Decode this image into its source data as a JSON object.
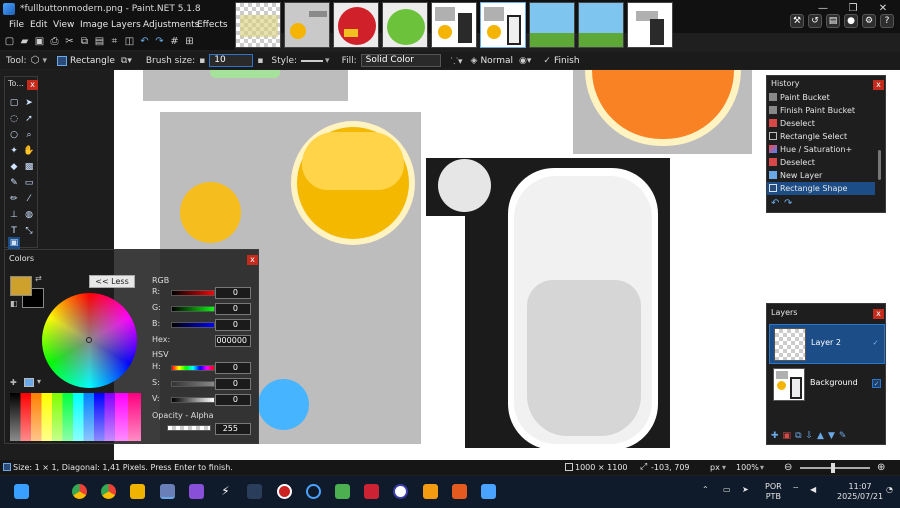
{
  "window": {
    "title": "*fullbuttonmodern.png - Paint.NET 5.1.8",
    "minimize": "—",
    "maximize": "❐",
    "close": "✕"
  },
  "menu": {
    "items": [
      "File",
      "Edit",
      "View",
      "Image",
      "Layers",
      "Adjustments",
      "Effects"
    ]
  },
  "tool_options": {
    "tool_label": "Tool:",
    "shape_label": "Rectangle",
    "brush_size_label": "Brush size:",
    "brush_size_value": "10",
    "style_label": "Style:",
    "fill_label": "Fill:",
    "fill_value": "Solid Color",
    "blend_value": "Normal",
    "finish_label": "Finish"
  },
  "tools_panel": {
    "title": "To..."
  },
  "colors_panel": {
    "title": "Colors",
    "less_button": "<< Less",
    "rgb_label": "RGB",
    "r_label": "R:",
    "g_label": "G:",
    "b_label": "B:",
    "r_value": "0",
    "g_value": "0",
    "b_value": "0",
    "hex_label": "Hex:",
    "hex_value": "000000",
    "hsv_label": "HSV",
    "h_label": "H:",
    "s_label": "S:",
    "v_label": "V:",
    "h_value": "0",
    "s_value": "0",
    "v_value": "0",
    "opacity_label": "Opacity - Alpha",
    "alpha_value": "255",
    "primary_color": "#cda12b",
    "secondary_color": "#000000"
  },
  "history_panel": {
    "title": "History",
    "items": [
      {
        "label": "Paint Bucket",
        "icon": "paint-bucket-icon"
      },
      {
        "label": "Finish Paint Bucket",
        "icon": "paint-bucket-icon"
      },
      {
        "label": "Deselect",
        "icon": "deselect-icon"
      },
      {
        "label": "Rectangle Select",
        "icon": "rectangle-select-icon"
      },
      {
        "label": "Hue / Saturation+",
        "icon": "hue-saturation-icon"
      },
      {
        "label": "Deselect",
        "icon": "deselect-icon"
      },
      {
        "label": "New Layer",
        "icon": "new-layer-icon"
      },
      {
        "label": "Rectangle Shape",
        "icon": "rectangle-shape-icon"
      }
    ]
  },
  "layers_panel": {
    "title": "Layers",
    "layers": [
      {
        "name": "Layer 2",
        "visible": true,
        "selected": true
      },
      {
        "name": "Background",
        "visible": true,
        "selected": false
      }
    ]
  },
  "status": {
    "message": "Size: 1 × 1, Diagonal: 1,41 Pixels. Press Enter to finish.",
    "image_size": "1000 × 1100",
    "cursor_pos": "-103, 709",
    "unit": "px",
    "zoom": "100%"
  },
  "taskbar": {
    "lang": "POR",
    "layout": "PTB",
    "time": "11:07",
    "date": "2025/07/21"
  },
  "colors": {
    "accent": "#2b76c9",
    "close_red": "#c42b1c"
  }
}
